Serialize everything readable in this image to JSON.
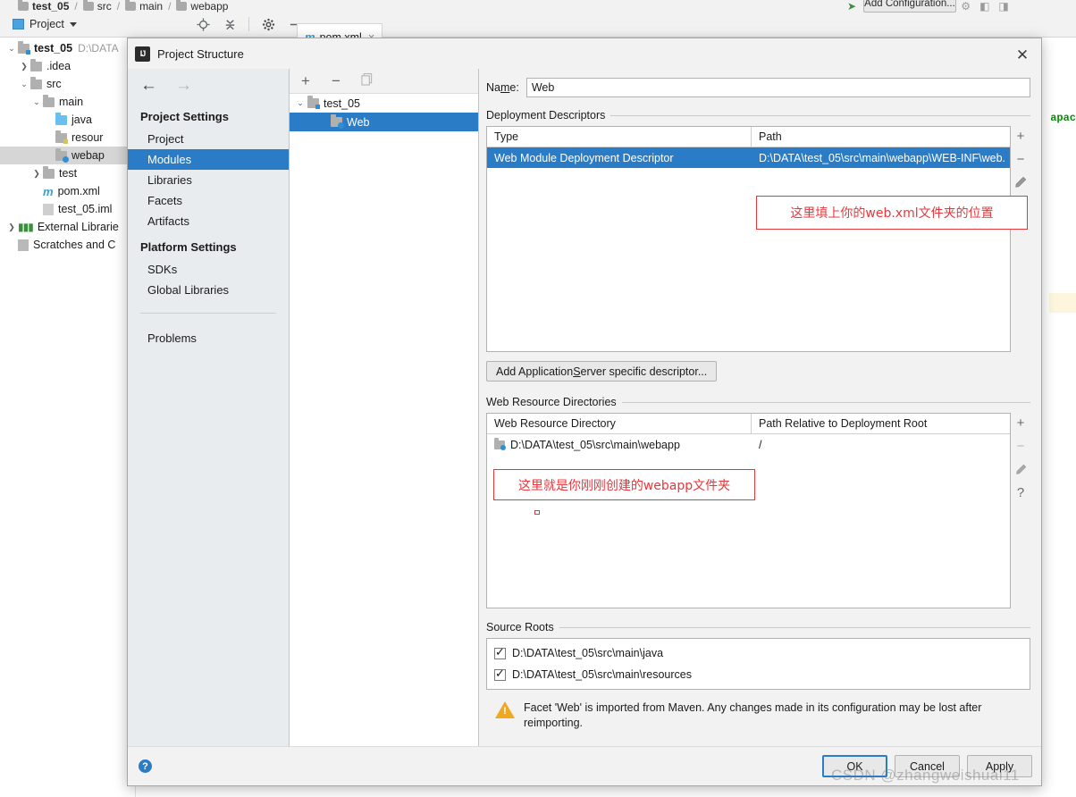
{
  "ide": {
    "breadcrumb": [
      "test_05",
      "src",
      "main",
      "webapp"
    ],
    "toolwindow_label": "Project",
    "editor_tab": "pom.xml",
    "editor_tab_icon": "maven-m-icon",
    "run_config_button": "Add Configuration...",
    "code_fragment": "apac",
    "tree": [
      {
        "label": "test_05",
        "path": "D:\\DATA",
        "icon": "module-folder-icon",
        "depth": 0,
        "twisty": "v",
        "bold": true
      },
      {
        "label": ".idea",
        "path": "",
        "icon": "folder-icon",
        "depth": 1,
        "twisty": ">",
        "bold": false
      },
      {
        "label": "src",
        "path": "",
        "icon": "folder-icon",
        "depth": 1,
        "twisty": "v",
        "bold": false
      },
      {
        "label": "main",
        "path": "",
        "icon": "folder-icon",
        "depth": 2,
        "twisty": "v",
        "bold": false
      },
      {
        "label": "java",
        "path": "",
        "icon": "source-folder-icon",
        "depth": 3,
        "twisty": "",
        "bold": false
      },
      {
        "label": "resour",
        "path": "",
        "icon": "resources-folder-icon",
        "depth": 3,
        "twisty": "",
        "bold": false
      },
      {
        "label": "webap",
        "path": "",
        "icon": "web-folder-icon",
        "depth": 3,
        "twisty": "",
        "bold": false,
        "selected": true
      },
      {
        "label": "test",
        "path": "",
        "icon": "folder-icon",
        "depth": 2,
        "twisty": ">",
        "bold": false
      },
      {
        "label": "pom.xml",
        "path": "",
        "icon": "maven-m-icon",
        "depth": 2,
        "twisty": "",
        "bold": false
      },
      {
        "label": "test_05.iml",
        "path": "",
        "icon": "iml-file-icon",
        "depth": 2,
        "twisty": "",
        "bold": false
      },
      {
        "label": "External Librarie",
        "path": "",
        "icon": "libraries-icon",
        "depth": 0,
        "twisty": ">",
        "bold": false
      },
      {
        "label": "Scratches and C",
        "path": "",
        "icon": "scratches-icon",
        "depth": 0,
        "twisty": "",
        "bold": false
      }
    ]
  },
  "dialog": {
    "title": "Project Structure",
    "close_icon": "close-icon",
    "nav": {
      "back_icon": "arrow-left-icon",
      "forward_icon": "arrow-right-icon",
      "groups": [
        {
          "title": "Project Settings",
          "items": [
            "Project",
            "Modules",
            "Libraries",
            "Facets",
            "Artifacts"
          ]
        },
        {
          "title": "Platform Settings",
          "items": [
            "SDKs",
            "Global Libraries"
          ]
        }
      ],
      "extra_items": [
        "Problems"
      ],
      "active": "Modules"
    },
    "module_tree": {
      "toolbar": [
        "add-icon",
        "remove-icon",
        "copy-icon"
      ],
      "nodes": [
        {
          "label": "test_05",
          "icon": "module-folder-icon",
          "depth": 0,
          "twisty": "v",
          "selected": false
        },
        {
          "label": "Web",
          "icon": "web-facet-icon",
          "depth": 1,
          "twisty": "",
          "selected": true
        }
      ]
    },
    "name_field": {
      "label": "Name:",
      "label_mnemonic": "m",
      "value": "Web"
    },
    "deployment_descriptors": {
      "section_title": "Deployment Descriptors",
      "columns": [
        "Type",
        "Path"
      ],
      "rows": [
        {
          "type": "Web Module Deployment Descriptor",
          "path": "D:\\DATA\\test_05\\src\\main\\webapp\\WEB-INF\\web.",
          "selected": true
        }
      ],
      "side_buttons": [
        "add-icon",
        "remove-icon",
        "edit-pencil-icon"
      ],
      "add_button": "Add Application Server specific descriptor..."
    },
    "web_resource_directories": {
      "section_title": "Web Resource Directories",
      "columns": [
        "Web Resource Directory",
        "Path Relative to Deployment Root"
      ],
      "rows": [
        {
          "directory": "D:\\DATA\\test_05\\src\\main\\webapp",
          "relative": "/",
          "selected": false
        }
      ],
      "side_buttons": [
        "add-icon",
        "remove-icon",
        "edit-pencil-icon",
        "help-icon"
      ]
    },
    "source_roots": {
      "section_title": "Source Roots",
      "items": [
        {
          "path": "D:\\DATA\\test_05\\src\\main\\java",
          "checked": true
        },
        {
          "path": "D:\\DATA\\test_05\\src\\main\\resources",
          "checked": true
        }
      ]
    },
    "warning": {
      "icon": "warning-triangle-icon",
      "text": "Facet 'Web' is imported from Maven. Any changes made in its configuration may be lost after reimporting."
    },
    "footer": {
      "help_icon": "help-circle-icon",
      "buttons": [
        "OK",
        "Cancel",
        "Apply"
      ],
      "default_button": "OK"
    }
  },
  "annotations": [
    {
      "id": "webxml",
      "text": "这里填上你的web.xml文件夹的位置",
      "color": "#e8373c"
    },
    {
      "id": "webapp",
      "text": "这里就是你刚刚创建的webapp文件夹",
      "color": "#e8373c"
    }
  ],
  "watermark": "CSDN @zhangweishuai11"
}
